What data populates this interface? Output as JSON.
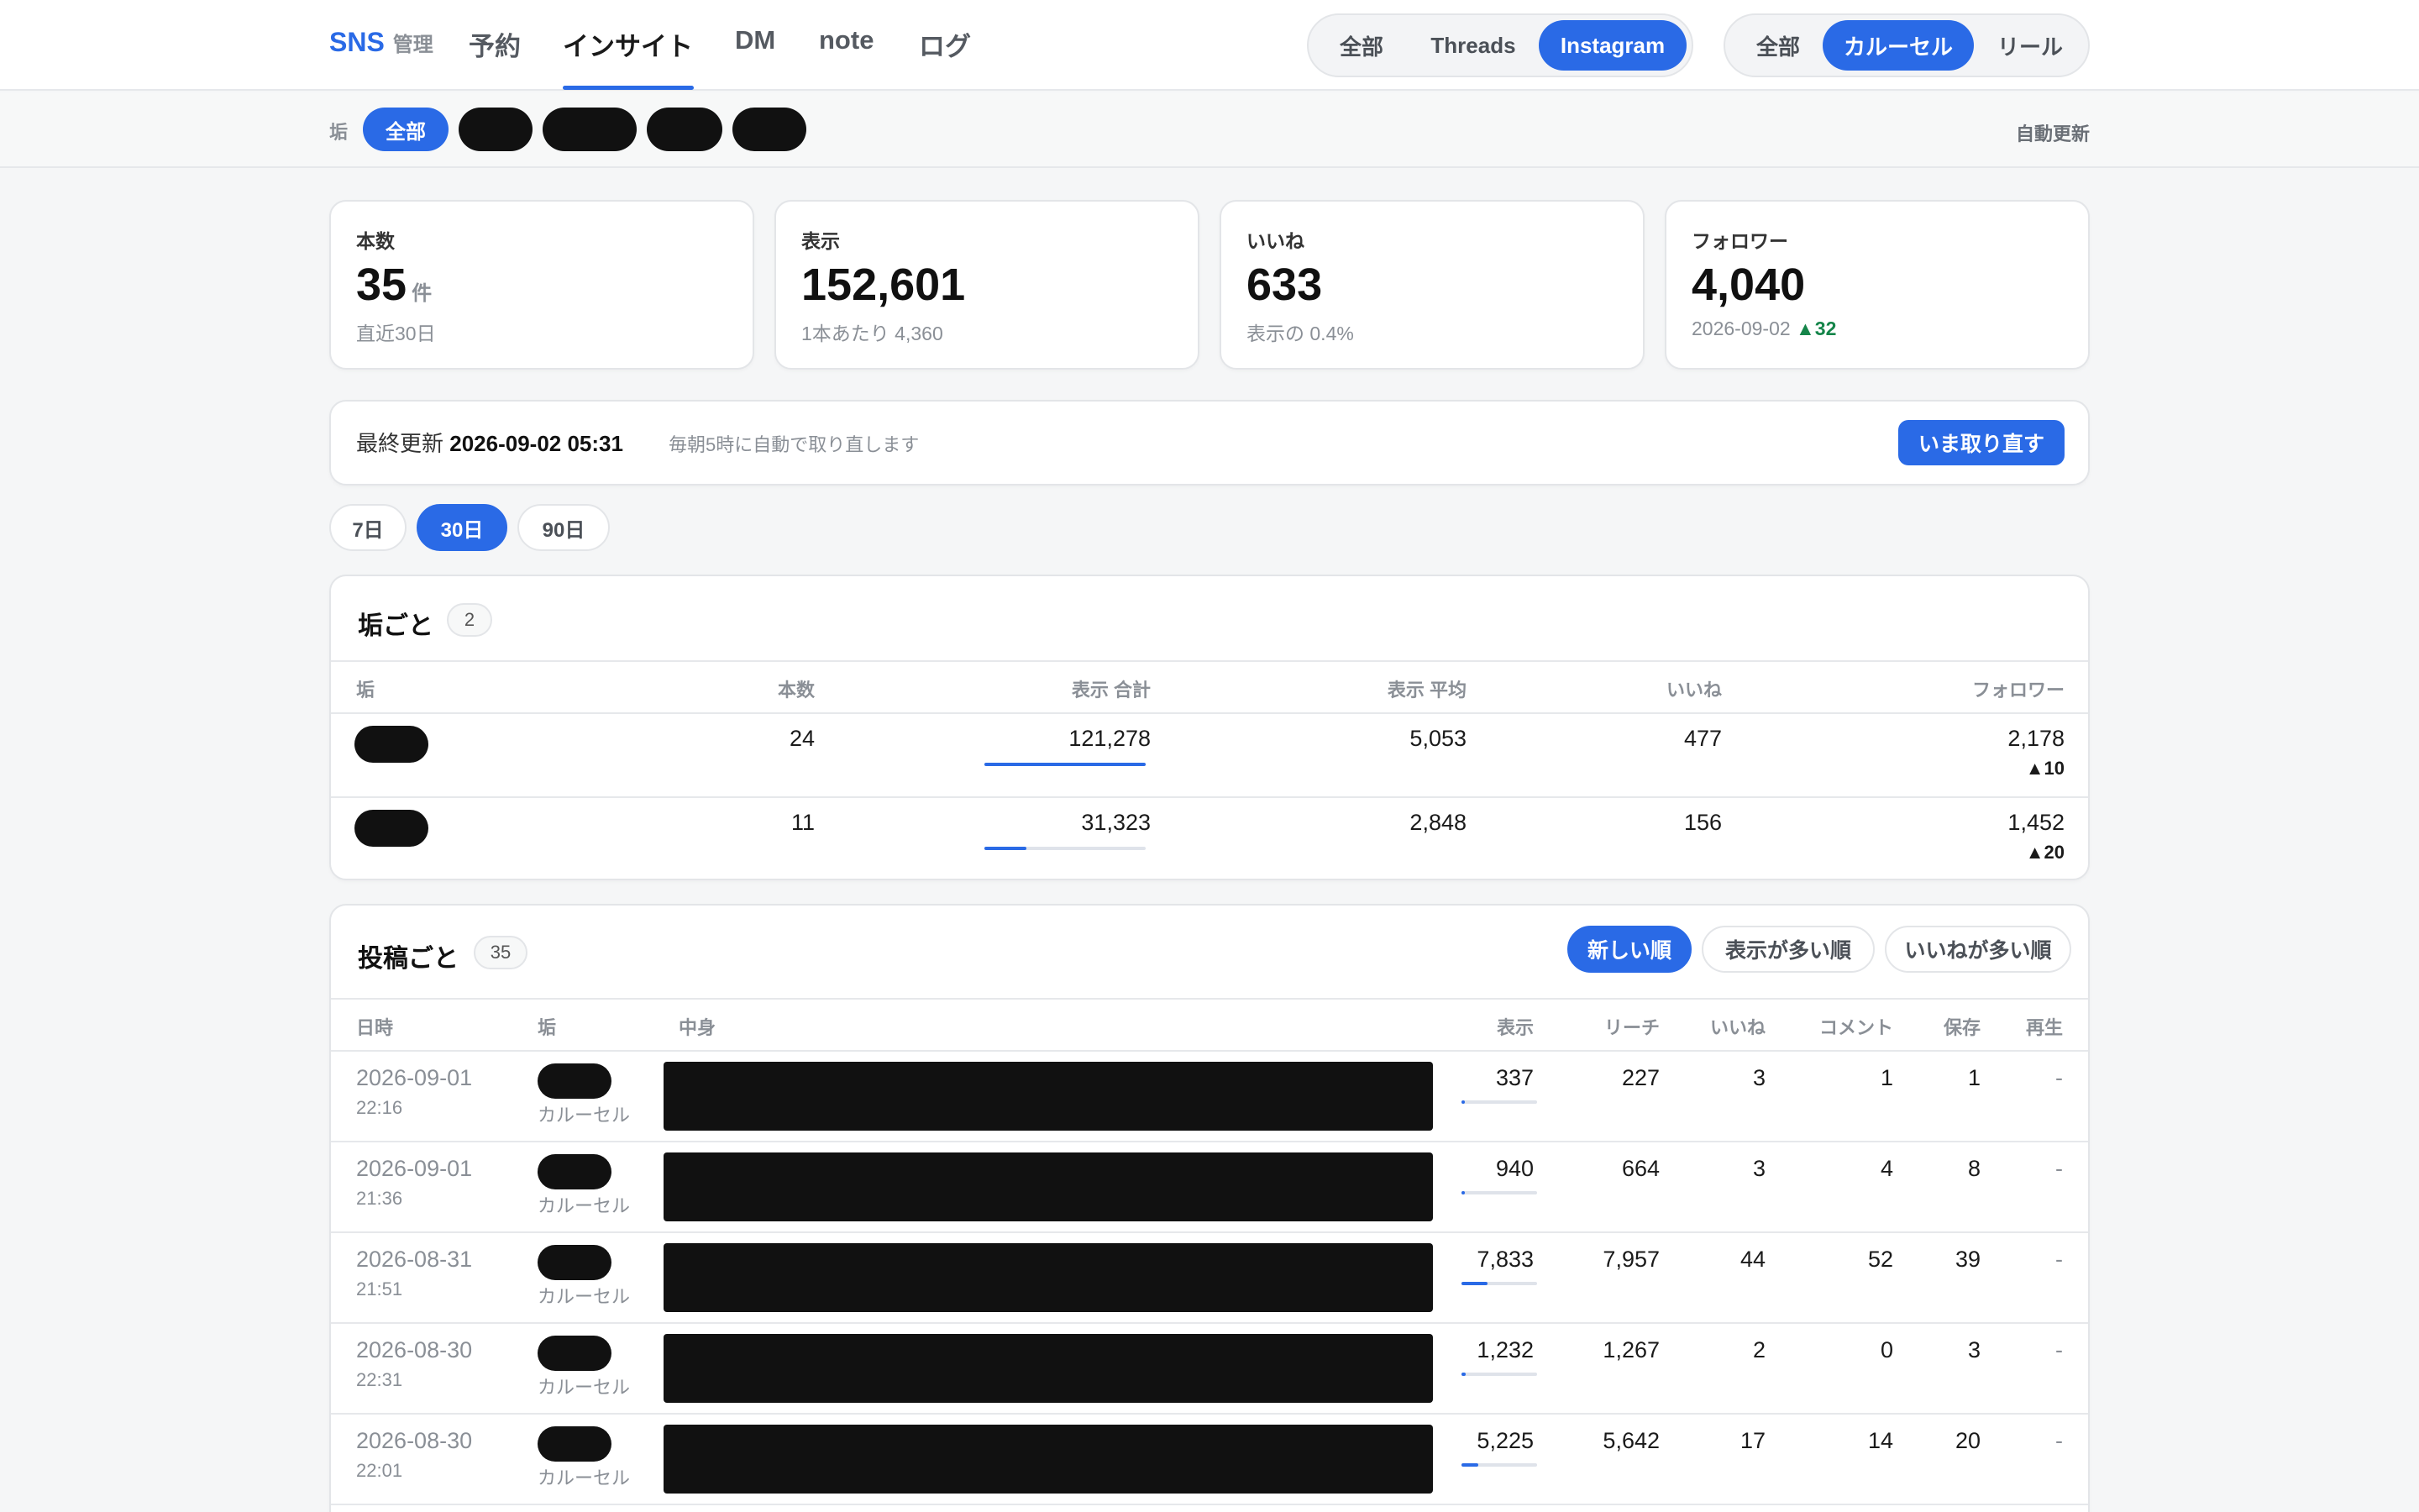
{
  "brand": {
    "main": "SNS",
    "sub": "管理"
  },
  "nav": [
    "予約",
    "インサイト",
    "DM",
    "note",
    "ログ"
  ],
  "nav_active": "インサイト",
  "platform_seg": [
    "全部",
    "Threads",
    "Instagram"
  ],
  "platform_active": "Instagram",
  "type_seg": [
    "全部",
    "カルーセル",
    "リール"
  ],
  "type_active": "カルーセル",
  "filter": {
    "label": "垢",
    "all": "全部",
    "auto_update": "自動更新"
  },
  "stats": [
    {
      "label": "本数",
      "value": "35",
      "unit": "件",
      "sub": "直近30日",
      "delta": ""
    },
    {
      "label": "表示",
      "value": "152,601",
      "unit": "",
      "sub": "1本あたり 4,360",
      "delta": ""
    },
    {
      "label": "いいね",
      "value": "633",
      "unit": "",
      "sub": "表示の 0.4%",
      "delta": ""
    },
    {
      "label": "フォロワー",
      "value": "4,040",
      "unit": "",
      "sub": "2026-09-02",
      "delta": "▲32"
    }
  ],
  "update": {
    "label": "最終更新",
    "timestamp": "2026-09-02 05:31",
    "note": "毎朝5時に自動で取り直します",
    "button": "いま取り直す"
  },
  "ranges": [
    "7日",
    "30日",
    "90日"
  ],
  "range_active": "30日",
  "accounts": {
    "title": "垢ごと",
    "count": "2",
    "headers": [
      "垢",
      "本数",
      "表示 合計",
      "表示 平均",
      "いいね",
      "フォロワー"
    ],
    "rows": [
      {
        "posts": "24",
        "views_total": "121,278",
        "views_share": 1.0,
        "views_avg": "5,053",
        "likes": "477",
        "followers": "2,178",
        "delta": "▲10"
      },
      {
        "posts": "11",
        "views_total": "31,323",
        "views_share": 0.26,
        "views_avg": "2,848",
        "likes": "156",
        "followers": "1,452",
        "delta": "▲20"
      }
    ]
  },
  "posts": {
    "title": "投稿ごと",
    "count": "35",
    "sort": [
      "新しい順",
      "表示が多い順",
      "いいねが多い順"
    ],
    "sort_active": "新しい順",
    "headers": [
      "日時",
      "垢",
      "中身",
      "表示",
      "リーチ",
      "いいね",
      "コメント",
      "保存",
      "再生"
    ],
    "rows": [
      {
        "date": "2026-09-01",
        "time": "22:16",
        "type": "カルーセル",
        "views": "337",
        "views_share": 0.04,
        "reach": "227",
        "likes": "3",
        "comments": "1",
        "saves": "1",
        "plays": "-"
      },
      {
        "date": "2026-09-01",
        "time": "21:36",
        "type": "カルーセル",
        "views": "940",
        "views_share": 0.04,
        "reach": "664",
        "likes": "3",
        "comments": "4",
        "saves": "8",
        "plays": "-"
      },
      {
        "date": "2026-08-31",
        "time": "21:51",
        "type": "カルーセル",
        "views": "7,833",
        "views_share": 0.34,
        "reach": "7,957",
        "likes": "44",
        "comments": "52",
        "saves": "39",
        "plays": "-"
      },
      {
        "date": "2026-08-30",
        "time": "22:31",
        "type": "カルーセル",
        "views": "1,232",
        "views_share": 0.05,
        "reach": "1,267",
        "likes": "2",
        "comments": "0",
        "saves": "3",
        "plays": "-"
      },
      {
        "date": "2026-08-30",
        "time": "22:01",
        "type": "カルーセル",
        "views": "5,225",
        "views_share": 0.22,
        "reach": "5,642",
        "likes": "17",
        "comments": "14",
        "saves": "20",
        "plays": "-"
      }
    ]
  },
  "colors": {
    "accent": "#2a6ae6",
    "positive": "#15854a",
    "redacted": "#111111"
  }
}
